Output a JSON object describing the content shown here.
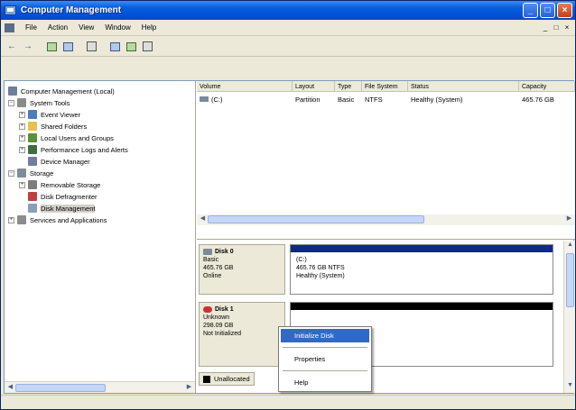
{
  "window": {
    "title": "Computer Management",
    "colors": {
      "titlebar": "#0a5ddb",
      "selection": "#316ac5",
      "primary_partition": "#0d2a8a",
      "unallocated": "#000000"
    }
  },
  "menubar": {
    "items": [
      "File",
      "Action",
      "View",
      "Window",
      "Help"
    ],
    "mdi_controls": [
      "_",
      "□",
      "×"
    ]
  },
  "toolbar": {
    "icons": [
      "back-arrow-icon",
      "forward-arrow-icon",
      "up-folder-icon",
      "show-hide-tree-icon",
      "help-icon",
      "properties-icon",
      "new-window-icon",
      "console-icon"
    ]
  },
  "tree": {
    "root": "Computer Management (Local)",
    "system_tools": {
      "label": "System Tools",
      "children": [
        "Event Viewer",
        "Shared Folders",
        "Local Users and Groups",
        "Performance Logs and Alerts",
        "Device Manager"
      ]
    },
    "storage": {
      "label": "Storage",
      "children": [
        "Removable Storage",
        "Disk Defragmenter",
        "Disk Management"
      ]
    },
    "services": "Services and Applications",
    "selected": "Disk Management"
  },
  "volumes": {
    "columns": [
      "Volume",
      "Layout",
      "Type",
      "File System",
      "Status",
      "Capacity"
    ],
    "rows": [
      {
        "volume": "(C:)",
        "layout": "Partition",
        "type": "Basic",
        "file_system": "NTFS",
        "status": "Healthy (System)",
        "capacity": "465.76 GB"
      }
    ]
  },
  "disks": [
    {
      "name": "Disk 0",
      "type": "Basic",
      "size": "465.76 GB",
      "state": "Online",
      "partition": {
        "label": "(C:)",
        "detail": "465.76 GB NTFS",
        "status": "Healthy (System)"
      }
    },
    {
      "name": "Disk 1",
      "type": "Unknown",
      "size": "298.09 GB",
      "state": "Not Initialized"
    }
  ],
  "legend": {
    "unallocated": "Unallocated"
  },
  "context_menu": {
    "items": [
      "Initialize Disk",
      "Properties",
      "Help"
    ],
    "highlighted": "Initialize Disk"
  },
  "status": {
    "text": ""
  }
}
